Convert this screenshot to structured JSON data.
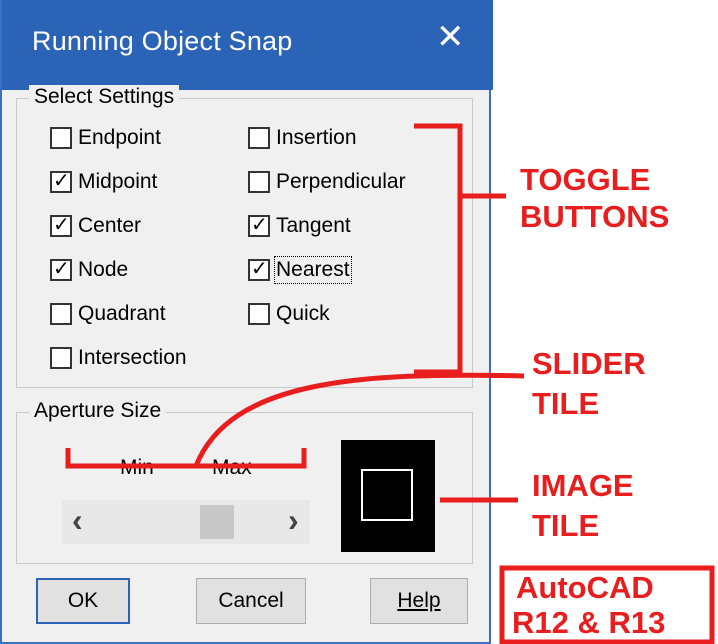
{
  "dialog": {
    "title": "Running Object Snap"
  },
  "select_settings": {
    "label": "Select Settings",
    "options": [
      {
        "label": "Endpoint",
        "checked": false
      },
      {
        "label": "Midpoint",
        "checked": true
      },
      {
        "label": "Center",
        "checked": true
      },
      {
        "label": "Node",
        "checked": true
      },
      {
        "label": "Quadrant",
        "checked": false
      },
      {
        "label": "Intersection",
        "checked": false
      },
      {
        "label": "Insertion",
        "checked": false
      },
      {
        "label": "Perpendicular",
        "checked": false
      },
      {
        "label": "Tangent",
        "checked": true
      },
      {
        "label": "Nearest",
        "checked": true
      },
      {
        "label": "Quick",
        "checked": false
      }
    ]
  },
  "aperture": {
    "label": "Aperture Size",
    "min_label": "Min",
    "max_label": "Max",
    "left_arrow": "‹",
    "right_arrow": "›",
    "value": 0.5
  },
  "buttons": {
    "ok": "OK",
    "cancel": "Cancel",
    "help": "Help"
  },
  "annotations": {
    "toggle_line1": "TOGGLE",
    "toggle_line2": "BUTTONS",
    "slider_line1": "SLIDER",
    "slider_line2": "TILE",
    "image_line1": "IMAGE",
    "image_line2": "TILE",
    "version_line1": "AutoCAD",
    "version_line2": "R12 & R13",
    "color": "#e81e1e"
  }
}
